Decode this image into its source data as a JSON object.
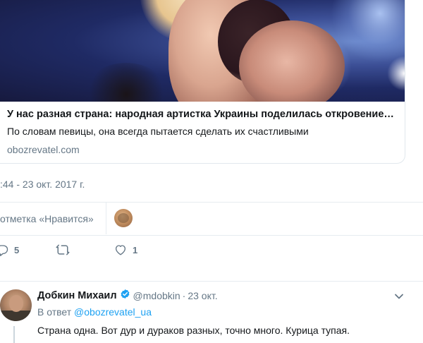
{
  "card": {
    "title": "У нас разная страна: народная артистка Украины поделилась откровение…",
    "description": "По словам певицы, она всегда пытается сделать их счастливыми",
    "domain": "obozrevatel.com"
  },
  "tweet": {
    "timestamp": ":44 - 23 окт. 2017 г.",
    "likes_label": "отметка «Нравится»",
    "replies_count": "5",
    "likes_count": "1"
  },
  "reply": {
    "name": "Добкин Михаил",
    "handle": "@mdobkin",
    "separator": "·",
    "time": "23 окт.",
    "reply_prefix": "В ответ",
    "reply_mention": "@obozrevatel_ua",
    "text": "Страна одна. Вот дур и дураков разных, точно много. Курица тупая."
  },
  "colors": {
    "accent": "#1da1f2",
    "secondary_text": "#657786",
    "divider": "#e6ecf0"
  },
  "icons": {
    "reply": "reply-icon",
    "retweet": "retweet-icon",
    "like": "heart-icon",
    "verified": "verified-badge-icon",
    "caret": "chevron-down-icon"
  }
}
